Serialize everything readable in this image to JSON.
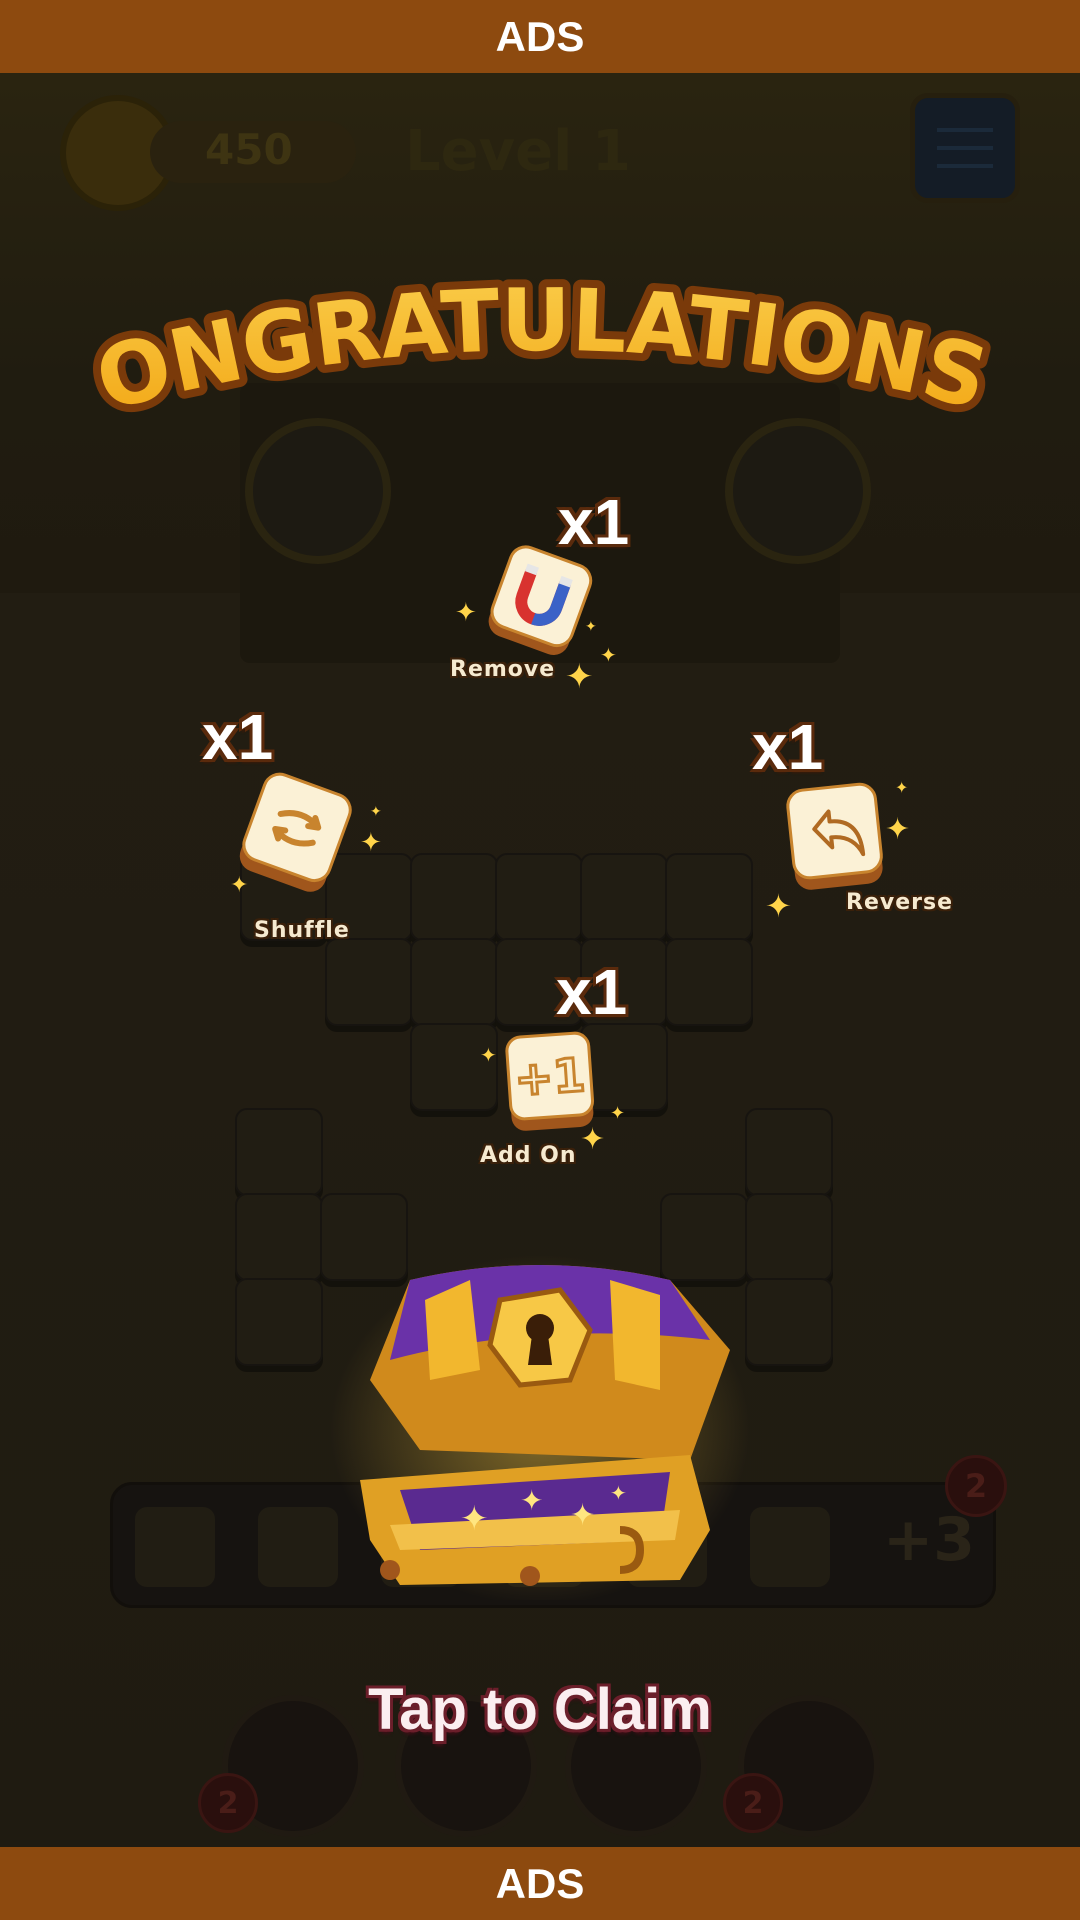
{
  "ads": {
    "top_label": "ADS",
    "bottom_label": "ADS"
  },
  "hud": {
    "coins": "450",
    "level": "Level 1"
  },
  "popup": {
    "title": "CONGRATULATIONS !",
    "claim_label": "Tap to Claim"
  },
  "rewards": [
    {
      "name": "Remove",
      "count": "x1",
      "icon": "magnet-icon"
    },
    {
      "name": "Shuffle",
      "count": "x1",
      "icon": "shuffle-icon"
    },
    {
      "name": "Reverse",
      "count": "x1",
      "icon": "undo-icon"
    },
    {
      "name": "Add On",
      "count": "x1",
      "icon": "plus-one-icon"
    }
  ],
  "tray": {
    "extra": "+3",
    "badge": "2"
  },
  "boosters": {
    "badge_left": "2",
    "badge_right": "2"
  },
  "colors": {
    "ads_bar": "#8d4a0f",
    "title_gold": "#f6c22a",
    "claim_outline": "#6b1e2a"
  }
}
